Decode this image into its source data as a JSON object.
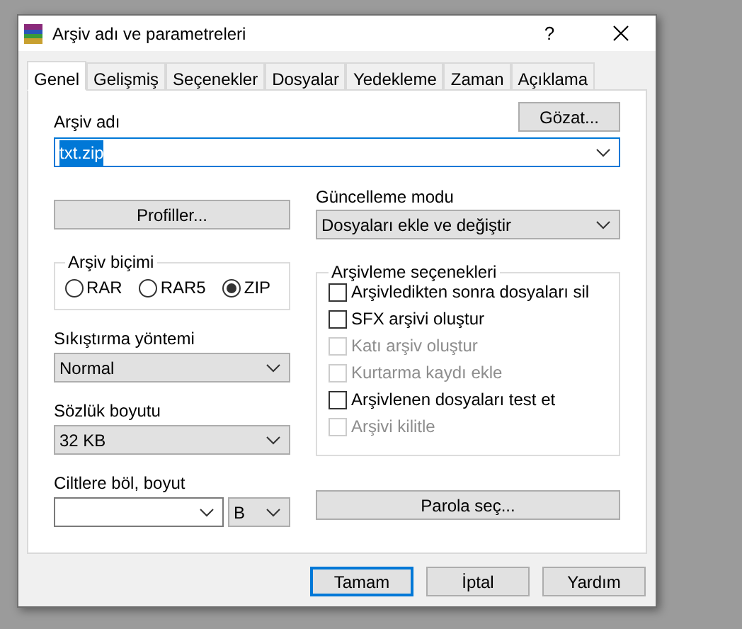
{
  "window": {
    "title": "Arşiv adı ve parametreleri",
    "help": "?"
  },
  "tabs": [
    {
      "label": "Genel",
      "selected": true
    },
    {
      "label": "Gelişmiş",
      "selected": false
    },
    {
      "label": "Seçenekler",
      "selected": false
    },
    {
      "label": "Dosyalar",
      "selected": false
    },
    {
      "label": "Yedekleme",
      "selected": false
    },
    {
      "label": "Zaman",
      "selected": false
    },
    {
      "label": "Açıklama",
      "selected": false
    }
  ],
  "archive_name": {
    "label": "Arşiv adı",
    "value": "txt.zip",
    "browse_button": "Gözat..."
  },
  "profiles_button": "Profiller...",
  "update_mode": {
    "label": "Güncelleme modu",
    "value": "Dosyaları ekle ve değiştir"
  },
  "archive_format": {
    "label": "Arşiv biçimi",
    "options": [
      {
        "label": "RAR",
        "selected": false
      },
      {
        "label": "RAR5",
        "selected": false
      },
      {
        "label": "ZIP",
        "selected": true
      }
    ]
  },
  "compression_method": {
    "label": "Sıkıştırma yöntemi",
    "value": "Normal"
  },
  "dictionary_size": {
    "label": "Sözlük boyutu",
    "value": "32 KB"
  },
  "split_volumes": {
    "label": "Ciltlere böl, boyut",
    "unit": "B"
  },
  "archiving_options": {
    "label": "Arşivleme seçenekleri",
    "items": [
      {
        "label": "Arşivledikten sonra dosyaları sil",
        "checked": false,
        "disabled": false
      },
      {
        "label": "SFX arşivi oluştur",
        "checked": false,
        "disabled": false
      },
      {
        "label": "Katı arşiv oluştur",
        "checked": false,
        "disabled": true
      },
      {
        "label": "Kurtarma kaydı ekle",
        "checked": false,
        "disabled": true
      },
      {
        "label": "Arşivlenen dosyaları test et",
        "checked": false,
        "disabled": false
      },
      {
        "label": "Arşivi kilitle",
        "checked": false,
        "disabled": true
      }
    ]
  },
  "password_button": "Parola seç...",
  "buttons": [
    {
      "label": "Tamam",
      "default": true
    },
    {
      "label": "İptal",
      "default": false
    },
    {
      "label": "Yardım",
      "default": false
    }
  ]
}
